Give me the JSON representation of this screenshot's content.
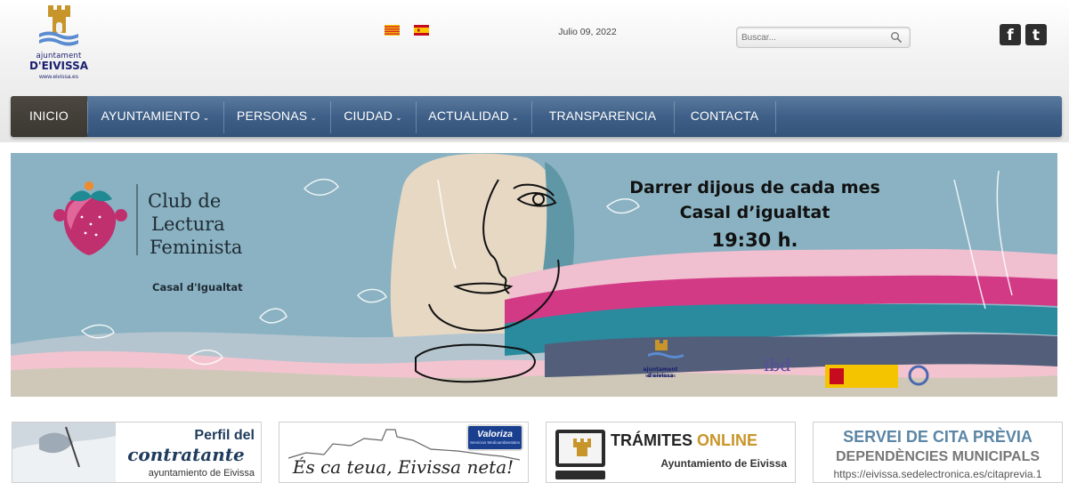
{
  "header": {
    "logo": {
      "line1": "ajuntament",
      "line2": "D'EIVISSA",
      "url": "www.eivissa.es"
    },
    "date": "Julio 09, 2022",
    "search": {
      "placeholder": "Buscar..."
    },
    "social": {
      "facebook": "f",
      "twitter": "t"
    }
  },
  "nav": {
    "items": [
      {
        "label": "INICIO",
        "has_submenu": false,
        "active": true
      },
      {
        "label": "AYUNTAMIENTO",
        "has_submenu": true
      },
      {
        "label": "PERSONAS",
        "has_submenu": true
      },
      {
        "label": "CIUDAD",
        "has_submenu": true
      },
      {
        "label": "ACTUALIDAD",
        "has_submenu": true
      },
      {
        "label": "TRANSPARENCIA",
        "has_submenu": false
      },
      {
        "label": "CONTACTA",
        "has_submenu": false
      }
    ],
    "chevron": "⌄"
  },
  "banner": {
    "club_line1": "Club de",
    "club_line2": "Lectura",
    "club_line3": "Feminista",
    "club_place": "Casal d'Igualtat",
    "event_line1": "Darrer dijous de cada mes",
    "event_line2": "Casal d’igualtat",
    "event_time": "19:30 h.",
    "sponsors": {
      "ajuntament": "ajuntament d'eivissa",
      "ajuntament_url": "www.eivissa.es",
      "ibd": "ibd"
    }
  },
  "cards": [
    {
      "title1": "Perfil del",
      "title2": "contratante",
      "subtitle": "ayuntamiento de Eivissa"
    },
    {
      "badge1": "Valoriza",
      "badge2": "Servicios Medioambientales",
      "slogan": "És ca teua, Eivissa neta!"
    },
    {
      "title": "TRÁMITES",
      "title_accent": "ONLINE",
      "subtitle": "Ayuntamiento de Eivissa"
    },
    {
      "title": "SERVEI DE CITA PRÈVIA",
      "subtitle": "DEPENDÈNCIES MUNICIPALS",
      "url": "https://eivissa.sedelectronica.es/citaprevia.1"
    }
  ],
  "colors": {
    "nav": "#3e5f87",
    "nav_active": "#45413a",
    "banner_bg": "#8ab2c2",
    "logo_gold": "#c8952a",
    "logo_blue": "#1a1f6d",
    "pink": "#d23a86",
    "teal": "#2a8a9e"
  }
}
